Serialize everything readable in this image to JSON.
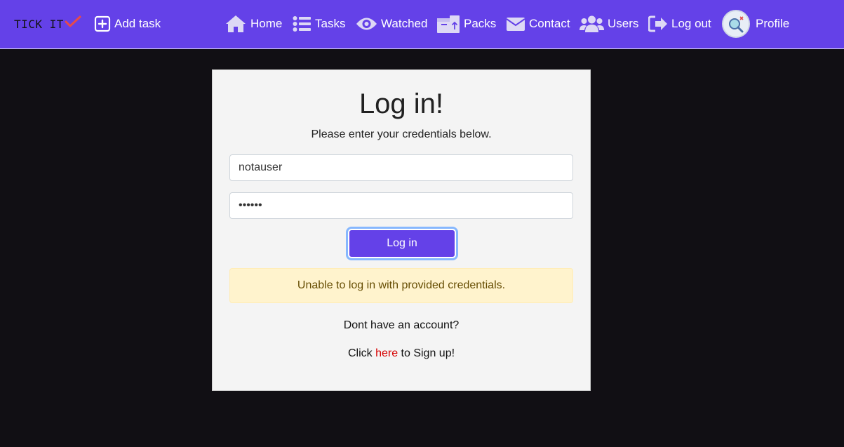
{
  "brand": {
    "name": "TICK IT"
  },
  "nav": {
    "add_task": "Add task",
    "home": "Home",
    "tasks": "Tasks",
    "watched": "Watched",
    "packs": "Packs",
    "contact": "Contact",
    "users": "Users",
    "logout": "Log out",
    "profile": "Profile"
  },
  "login": {
    "title": "Log in!",
    "subtitle": "Please enter your credentials below.",
    "username_value": "notauser",
    "password_value": "••••••",
    "button_label": "Log in",
    "error": "Unable to log in with provided credentials.",
    "no_account": "Dont have an account?",
    "signup_prefix": "Click ",
    "signup_link": "here",
    "signup_suffix": " to Sign up!"
  },
  "colors": {
    "navbar": "#6441e8",
    "background": "#110f14",
    "card": "#f4f4f4",
    "alert_bg": "#fff3cd",
    "link": "#d60000"
  }
}
